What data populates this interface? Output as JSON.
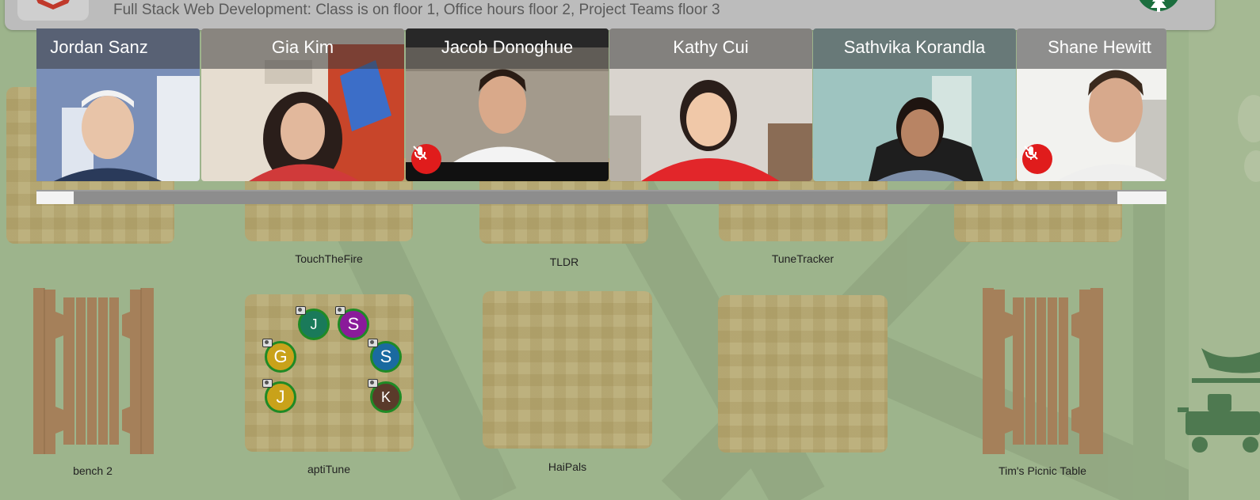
{
  "banner": {
    "title": "Full Stack Web Development: Class is on floor 1, Office hours floor 2, Project Teams floor 3"
  },
  "video_tiles": [
    {
      "name": "Jordan Sanz",
      "muted": false
    },
    {
      "name": "Gia Kim",
      "muted": false
    },
    {
      "name": "Jacob Donoghue",
      "muted": true
    },
    {
      "name": "Kathy Cui",
      "muted": false
    },
    {
      "name": "Sathvika Korandla",
      "muted": false
    },
    {
      "name": "Shane Hewitt",
      "muted": true
    }
  ],
  "tables": {
    "touchthefire": "TouchTheFire",
    "tldr": "TLDR",
    "tunetracker": "TuneTracker",
    "bench2": "bench 2",
    "aptitune": "aptiTune",
    "haipals": "HaiPals",
    "tims_picnic": "Tim's Picnic Table"
  },
  "avatars": [
    {
      "initial": "J",
      "color": "#1a7a5a"
    },
    {
      "initial": "S",
      "color": "#8a1a9a"
    },
    {
      "initial": "G",
      "color": "#c9a21a"
    },
    {
      "initial": "S",
      "color": "#1a6aa0"
    },
    {
      "initial": "J",
      "color": "#c9a21a"
    },
    {
      "initial": "K",
      "color": "#5a3a2a"
    }
  ],
  "colors": {
    "grass": "#9db48c",
    "table": "#bdb17e",
    "bench": "#a5805a",
    "mute": "#e01c1c",
    "avatar_ring": "#1f8a25"
  },
  "icons": [
    "logo-icon",
    "tree-icon",
    "camera-icon",
    "mic-off-icon",
    "picnic-cart-icon"
  ]
}
